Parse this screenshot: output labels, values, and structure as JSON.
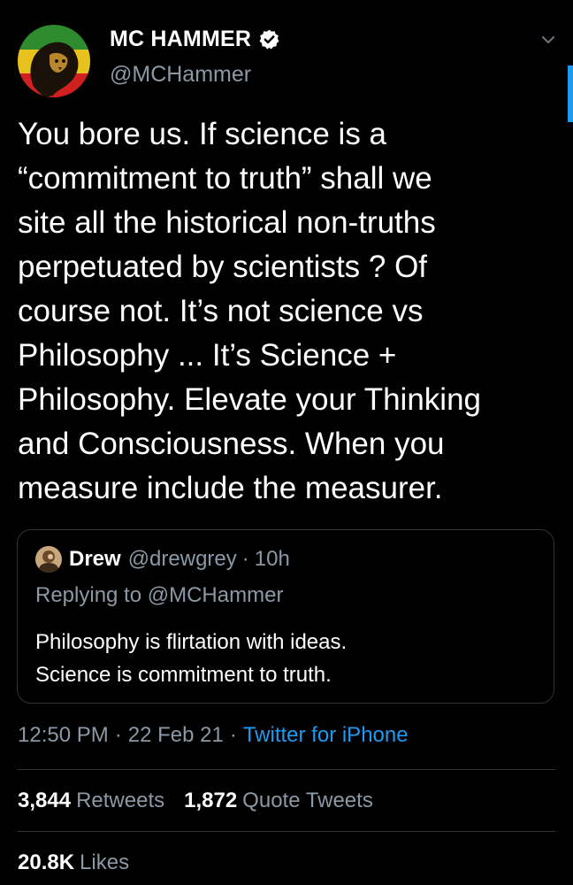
{
  "author": {
    "name": "MC HAMMER",
    "handle": "@MCHammer",
    "verified": true
  },
  "tweet": {
    "lines": [
      "You bore us. If science is a",
      "“commitment to truth” shall we",
      "site all the historical non-truths",
      "perpetuated by scientists ? Of",
      "course not. It’s not science vs",
      "Philosophy ... It’s Science +",
      "Philosophy. Elevate your Thinking",
      "and Consciousness. When you",
      "measure include the measurer."
    ]
  },
  "quote": {
    "name": "Drew",
    "handle": "@drewgrey",
    "separator": "·",
    "time": "10h",
    "replying_to": "Replying to @MCHammer",
    "lines": [
      "Philosophy is flirtation with ideas.",
      "Science is commitment to truth."
    ]
  },
  "meta": {
    "time": "12:50 PM",
    "separator": "·",
    "date": "22 Feb 21",
    "source": "Twitter for iPhone"
  },
  "stats": {
    "retweets_count": "3,844",
    "retweets_label": "Retweets",
    "quotes_count": "1,872",
    "quotes_label": "Quote Tweets",
    "likes_count": "20.8K",
    "likes_label": "Likes"
  },
  "icons": {
    "verified": "verified-badge-icon",
    "more": "chevron-down-icon"
  },
  "colors": {
    "background": "#000000",
    "text": "#ffffff",
    "secondary": "#8b98a5",
    "accent": "#1d9bf0",
    "border": "#2f3336"
  }
}
